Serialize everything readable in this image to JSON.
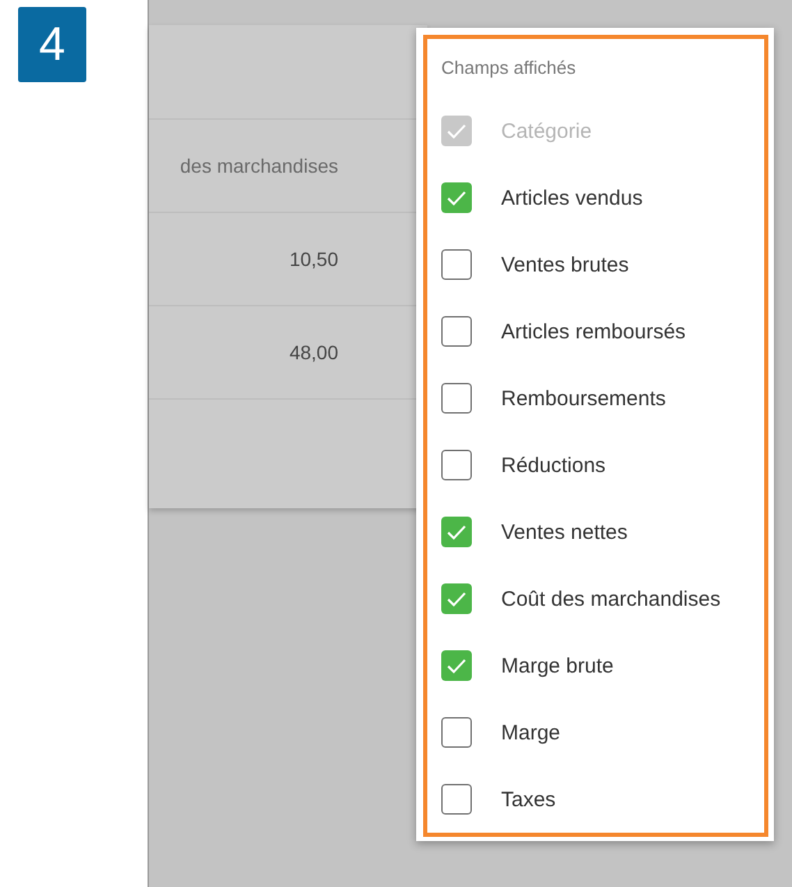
{
  "step_badge": "4",
  "table": {
    "column_header": "des marchandises",
    "rows": [
      "10,50",
      "48,00"
    ]
  },
  "fields_menu": {
    "title": "Champs affichés",
    "items": [
      {
        "label": "Catégorie",
        "checked": true,
        "disabled": true
      },
      {
        "label": "Articles vendus",
        "checked": true,
        "disabled": false
      },
      {
        "label": "Ventes brutes",
        "checked": false,
        "disabled": false
      },
      {
        "label": "Articles remboursés",
        "checked": false,
        "disabled": false
      },
      {
        "label": "Remboursements",
        "checked": false,
        "disabled": false
      },
      {
        "label": "Réductions",
        "checked": false,
        "disabled": false
      },
      {
        "label": "Ventes nettes",
        "checked": true,
        "disabled": false
      },
      {
        "label": "Coût des marchandises",
        "checked": true,
        "disabled": false
      },
      {
        "label": "Marge brute",
        "checked": true,
        "disabled": false
      },
      {
        "label": "Marge",
        "checked": false,
        "disabled": false
      },
      {
        "label": "Taxes",
        "checked": false,
        "disabled": false
      }
    ]
  }
}
